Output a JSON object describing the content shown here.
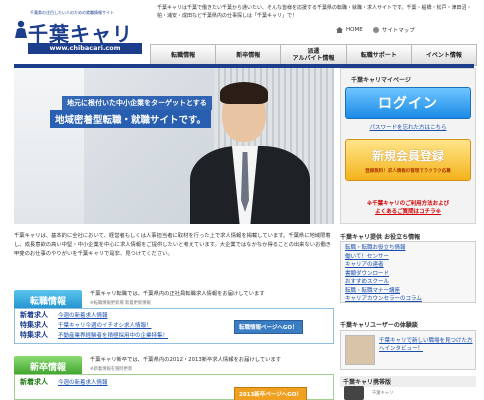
{
  "header": {
    "logo_tagline": "千葉県の注目したい人のための就職情報サイト",
    "logo_main": "千葉キャリ",
    "logo_url": "www.chibacari.com",
    "intro": "千葉キャリは千葉で働きたい千葉から通いたい、そんな皆様を応援する千葉県の転職・就職・求人サイトです。千葉・船橋・松戸・津田沼・柏・浦安・成田など千葉県内の仕事探しは「千葉キャリ」で！",
    "home_label": "HOME",
    "sitemap_label": "サイトマップ"
  },
  "nav": [
    {
      "label": "転職情報"
    },
    {
      "label": "新卒情報"
    },
    {
      "label": "派遣\nアルバイト情報"
    },
    {
      "label": "転職サポート"
    },
    {
      "label": "イベント情報"
    }
  ],
  "hero": {
    "caption1": "地元に根付いた中小企業をターゲットとする",
    "caption2": "地域密着型転職・就職サイトです。"
  },
  "mypage": {
    "title": "千葉キャリマイページ",
    "login": "ログイン",
    "forgot_password": "パスワードを忘れた方はこちら",
    "register": "新規会員登録",
    "register_note": "登録無料！求人情報の管理でラクラク応募"
  },
  "notice": {
    "line1": "※千葉キャリのご利用方法および",
    "line2": "よくあるご質問はコチラ※"
  },
  "intro_paragraph": "千葉キャリは、基本的に全社において、経営者もしくは人事担当者に取材を行った上で求人情報を掲載しています。千葉県に地域限着し、成長意欲の高い中堅・中小企業を中心に求人情報をご提供したいと考えています。大企業ではなかなか得ることの出来ないお働き甲斐のお仕事のやりがいを千葉キャリで是非、見つけてください。",
  "career_section": {
    "heading": "転職情報",
    "description": "千葉キャリ転職では、千葉県内の正社員転職求人情報をお届けしています",
    "updated": "※転職情報更新場 新着更新情報",
    "tags": [
      "新着求人",
      "特集求人",
      "特集求人"
    ],
    "links": [
      "今週の新着求人情報",
      "千葉キャリ今週のイチオシ求人情報！",
      "不動産業界経験者を積極採用中の企業特集！"
    ],
    "more": "転職情報ページへGO！"
  },
  "newgrad_section": {
    "heading": "新卒情報",
    "description": "千葉キャリ新卒では、千葉県内の2012・2013新卒求人情報をお届けしています",
    "updated": "※新着情報を随時更新",
    "tags": [
      "新着求人"
    ],
    "links": [
      "今週の新着求人情報"
    ],
    "more": "2013新卒ページへGO！"
  },
  "right_sidebar": {
    "useful_title": "千葉キャリ提供 お役立ち情報",
    "useful_links": [
      "転職・転職お役立ち情報",
      "働いて！センサー",
      "キャリアの達者",
      "書類ダウンロード",
      "おすすめスクール",
      "転職・転職マナー講座",
      "キャリアカウンセラーのコラム"
    ],
    "experience_title": "千葉キャリユーザーの体験談",
    "experience_link": "千葉キャリで新しい職場を見つけた方へインタビュー！",
    "mobile_title": "千葉キャリ携帯版",
    "mobile_note": "千葉キャリ"
  },
  "colors": {
    "brand_blue": "#1c3c8c",
    "login_blue": "#1b8ae6",
    "register_orange": "#f3b21b",
    "notice_red": "#d40000"
  }
}
